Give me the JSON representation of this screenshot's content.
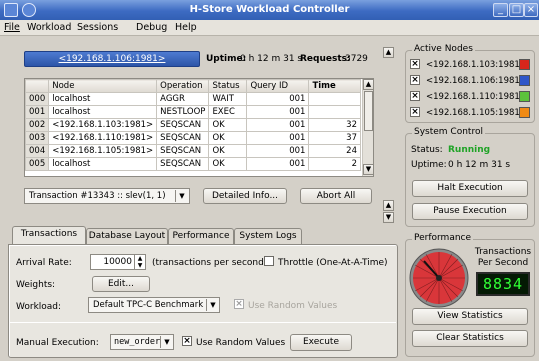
{
  "window": {
    "title": "H-Store Workload Controller"
  },
  "menu": [
    "File",
    "Workload",
    "Sessions",
    "Debug",
    "Help"
  ],
  "header": {
    "host_button": "<192.168.1.106:1981>",
    "uptime_label": "Uptime:",
    "uptime_value": "0 h 12 m 31 s",
    "requests_label": "Requests:",
    "requests_value": "3729"
  },
  "table": {
    "columns": [
      "Node",
      "Operation",
      "Status",
      "Query ID",
      "Time"
    ],
    "rows": [
      {
        "rn": "000",
        "node": "localhost",
        "op": "AGGR",
        "status": "WAIT",
        "qid": "001",
        "time": ""
      },
      {
        "rn": "001",
        "node": "localhost",
        "op": "NESTLOOP",
        "status": "EXEC",
        "qid": "001",
        "time": ""
      },
      {
        "rn": "002",
        "node": "<192.168.1.103:1981>",
        "op": "SEQSCAN",
        "status": "OK",
        "qid": "001",
        "time": "32"
      },
      {
        "rn": "003",
        "node": "<192.168.1.110:1981>",
        "op": "SEQSCAN",
        "status": "OK",
        "qid": "001",
        "time": "37"
      },
      {
        "rn": "004",
        "node": "<192.168.1.105:1981>",
        "op": "SEQSCAN",
        "status": "OK",
        "qid": "001",
        "time": "24"
      },
      {
        "rn": "005",
        "node": "localhost",
        "op": "SEQSCAN",
        "status": "OK",
        "qid": "001",
        "time": "2"
      }
    ]
  },
  "transaction": {
    "selected": "Transaction #13343 :: slev(1, 1)",
    "detailed_info": "Detailed Info...",
    "abort_all": "Abort All"
  },
  "tabs": [
    "Transactions",
    "Database Layout",
    "Performance",
    "System Logs"
  ],
  "form": {
    "arrival_label": "Arrival Rate:",
    "arrival_value": "10000",
    "arrival_unit": "(transactions per second)",
    "throttle_label": "Throttle (One-At-A-Time)",
    "weights_label": "Weights:",
    "weights_button": "Edit...",
    "workload_label": "Workload:",
    "workload_value": "Default TPC-C Benchmark",
    "use_random_disabled": "Use Random Values",
    "manual_label": "Manual Execution:",
    "manual_value": "new_order",
    "use_random": "Use Random Values",
    "execute": "Execute"
  },
  "active_nodes": {
    "title": "Active Nodes",
    "items": [
      {
        "label": "<192.168.1.103:1981>",
        "color": "#d8261c"
      },
      {
        "label": "<192.168.1.106:1981>",
        "color": "#2f56c8"
      },
      {
        "label": "<192.168.1.110:1981>",
        "color": "#5cc23c"
      },
      {
        "label": "<192.168.1.105:1981>",
        "color": "#ef8a14"
      }
    ]
  },
  "system_control": {
    "title": "System Control",
    "status_label": "Status:",
    "status_value": "Running",
    "status_color": "#1fa326",
    "uptime_label": "Uptime:",
    "uptime_value": "0 h 12 m 31 s",
    "halt": "Halt Execution",
    "pause": "Pause Execution"
  },
  "performance": {
    "title": "Performance",
    "caption_line1": "Transactions",
    "caption_line2": "Per Second",
    "lcd_value": "8834",
    "view_stats": "View Statistics",
    "clear_stats": "Clear Statistics"
  }
}
